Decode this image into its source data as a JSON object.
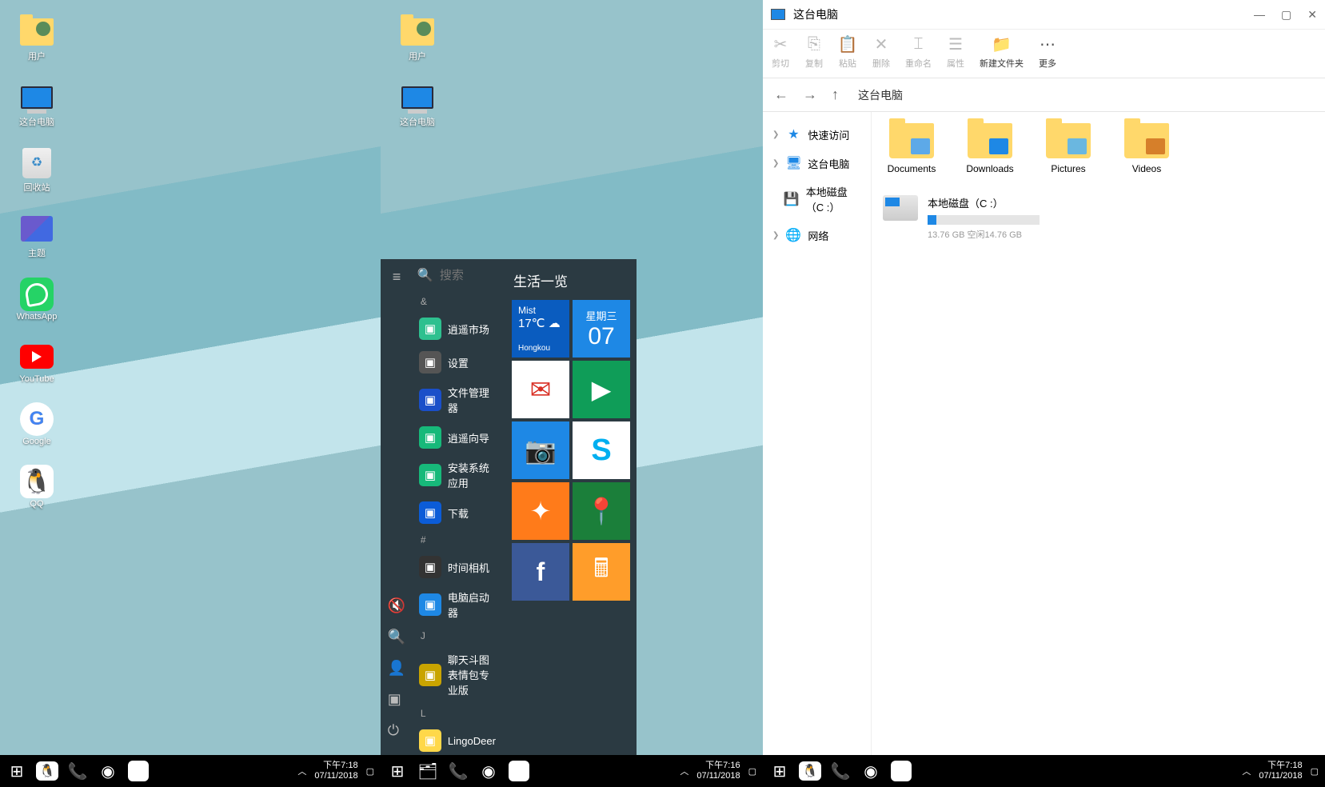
{
  "panel1": {
    "icons": [
      {
        "name": "user-folder",
        "label": "用户"
      },
      {
        "name": "this-pc",
        "label": "这台电脑"
      },
      {
        "name": "recycle-bin",
        "label": "回收站"
      },
      {
        "name": "themes",
        "label": "主题"
      },
      {
        "name": "whatsapp",
        "label": "WhatsApp"
      },
      {
        "name": "youtube",
        "label": "YouTube"
      },
      {
        "name": "google",
        "label": "Google"
      },
      {
        "name": "qq",
        "label": "QQ"
      }
    ],
    "taskbar": {
      "time": "下午7:18",
      "date": "07/11/2018"
    }
  },
  "panel2": {
    "icons": [
      {
        "name": "user-folder",
        "label": "用户"
      },
      {
        "name": "this-pc",
        "label": "这台电脑"
      }
    ],
    "start": {
      "search_placeholder": "搜索",
      "title": "生活一览",
      "weather": {
        "cond": "Mist",
        "temp": "17℃",
        "icon": "☁",
        "loc": "Hongkou"
      },
      "dateTile": {
        "weekday": "星期三",
        "day": "07"
      },
      "sections": {
        "amp": "&",
        "j": "J",
        "l": "L",
        "hash": "#"
      },
      "apps": [
        {
          "label": "逍遥市场",
          "bg": "#2ec08f"
        },
        {
          "label": "设置",
          "bg": "#555"
        },
        {
          "label": "文件管理器",
          "bg": "#1a4fc9"
        },
        {
          "label": "逍遥向导",
          "bg": "#17b97a"
        },
        {
          "label": "安装系统应用",
          "bg": "#17b97a"
        },
        {
          "label": "下载",
          "bg": "#0b5cd8"
        },
        {
          "label": "时间相机",
          "bg": "#333"
        },
        {
          "label": "电脑启动器",
          "bg": "#1e88e5"
        },
        {
          "label": "聊天斗图表情包专业版",
          "bg": "#c9a400"
        },
        {
          "label": "LingoDeer",
          "bg": "#ffd84a"
        }
      ]
    },
    "taskbar": {
      "time": "下午7:16",
      "date": "07/11/2018"
    }
  },
  "panel3": {
    "title": "这台电脑",
    "toolbar": [
      {
        "name": "cut",
        "label": "剪切",
        "glyph": "✂"
      },
      {
        "name": "copy",
        "label": "复制",
        "glyph": "⎘"
      },
      {
        "name": "paste",
        "label": "粘贴",
        "glyph": "📋"
      },
      {
        "name": "delete",
        "label": "删除",
        "glyph": "✕"
      },
      {
        "name": "rename",
        "label": "重命名",
        "glyph": "⌶"
      },
      {
        "name": "properties",
        "label": "属性",
        "glyph": "☰"
      },
      {
        "name": "new-folder",
        "label": "新建文件夹",
        "glyph": "📁",
        "active": true
      },
      {
        "name": "more",
        "label": "更多",
        "glyph": "⋯",
        "active": true
      }
    ],
    "address": "这台电脑",
    "sidebar": [
      {
        "name": "quick-access",
        "label": "快速访问",
        "icon": "★",
        "color": "#1e88e5",
        "exp": true
      },
      {
        "name": "this-pc",
        "label": "这台电脑",
        "icon": "🖥",
        "color": "#1e88e5",
        "exp": true
      },
      {
        "name": "local-disk",
        "label": "本地磁盘（C :）",
        "icon": "💾",
        "color": "#1e88e5"
      },
      {
        "name": "network",
        "label": "网络",
        "icon": "🌐",
        "color": "#1e88e5",
        "exp": true
      }
    ],
    "folders": [
      {
        "name": "documents",
        "label": "Documents",
        "overlay": "#5da9e8"
      },
      {
        "name": "downloads",
        "label": "Downloads",
        "overlay": "#1e88e5"
      },
      {
        "name": "pictures",
        "label": "Pictures",
        "overlay": "#6ab7e0"
      },
      {
        "name": "videos",
        "label": "Videos",
        "overlay": "#d67f2a"
      }
    ],
    "drive": {
      "name": "本地磁盘（C :）",
      "text": "13.76 GB 空闲14.76 GB",
      "fill": 8
    },
    "taskbar": {
      "time": "下午7:18",
      "date": "07/11/2018"
    }
  }
}
